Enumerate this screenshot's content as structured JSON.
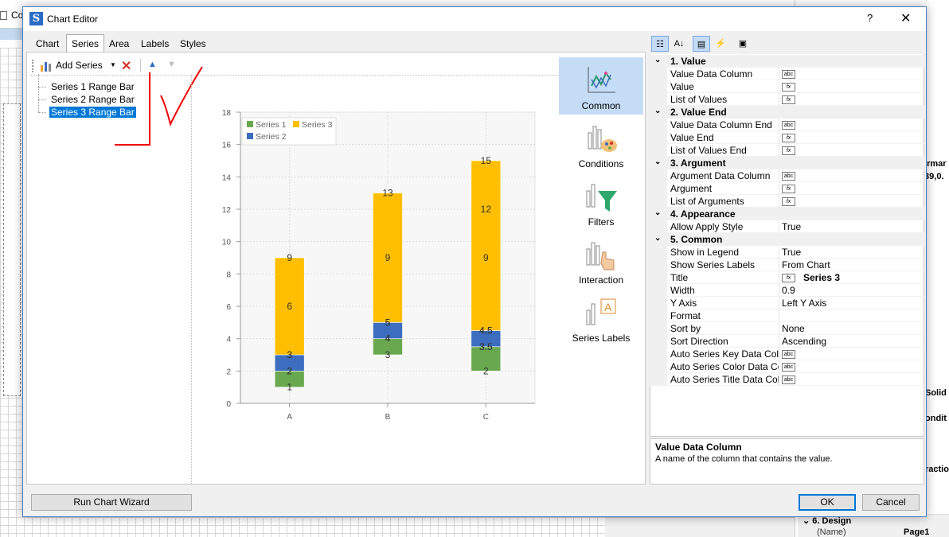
{
  "background": {
    "title": "Co",
    "right_fragments": [
      "r",
      "it",
      "ermar",
      ".39,0.",
      "Solid",
      "ondit",
      "ractio"
    ],
    "design_section": "6. Design",
    "design_name_label": "(Name)",
    "design_name_value": "Page1"
  },
  "dialog": {
    "title": "Chart Editor",
    "help": "?",
    "close": "✕"
  },
  "tabs": [
    "Chart",
    "Series",
    "Area",
    "Labels",
    "Styles"
  ],
  "active_tab": "Series",
  "toolbar": {
    "add_series": "Add Series",
    "caret": "▼",
    "delete_icon": "✕",
    "up_icon": "▲",
    "down_icon": "▼"
  },
  "series_list": [
    {
      "label": "Series 1 Range Bar",
      "selected": false
    },
    {
      "label": "Series 2 Range Bar",
      "selected": false
    },
    {
      "label": "Series 3 Range Bar",
      "selected": true
    }
  ],
  "nav": [
    {
      "label": "Common",
      "active": true
    },
    {
      "label": "Conditions",
      "active": false
    },
    {
      "label": "Filters",
      "active": false
    },
    {
      "label": "Interaction",
      "active": false
    },
    {
      "label": "Series Labels",
      "active": false
    }
  ],
  "chart_data": {
    "type": "bar",
    "subtype": "range-bar-stacked",
    "categories": [
      "A",
      "B",
      "C"
    ],
    "ylim": [
      0,
      18
    ],
    "yticks": [
      0,
      2,
      4,
      6,
      8,
      10,
      12,
      14,
      16,
      18
    ],
    "grid": true,
    "legend": [
      "Series 1",
      "Series 3",
      "Series 2"
    ],
    "legend_position": "top-left",
    "series": [
      {
        "name": "Series 1",
        "color": "#6aa84f",
        "ranges": [
          [
            1,
            2
          ],
          [
            3,
            4
          ],
          [
            2,
            3.5
          ]
        ],
        "labels": [
          [
            "1",
            "2"
          ],
          [
            "3",
            "4"
          ],
          [
            "2",
            "3.5"
          ]
        ]
      },
      {
        "name": "Series 2",
        "color": "#3c6dbf",
        "ranges": [
          [
            2,
            3
          ],
          [
            4,
            5
          ],
          [
            3.5,
            4.5
          ]
        ],
        "labels": [
          [
            "2",
            "3"
          ],
          [
            "4",
            "5"
          ],
          [
            "3.5",
            "4.5"
          ]
        ]
      },
      {
        "name": "Series 3",
        "color": "#ffbf00",
        "ranges": [
          [
            3,
            9
          ],
          [
            5,
            13
          ],
          [
            4.5,
            15
          ]
        ],
        "labels": [
          [
            "3",
            "6",
            "9"
          ],
          [
            "5",
            "9",
            "13"
          ],
          [
            "4.5",
            "9",
            "12",
            "15"
          ]
        ]
      }
    ]
  },
  "property_grid": {
    "toolbar": [
      "categorized-icon",
      "alphabetical-icon",
      "properties-icon",
      "events-icon",
      "pages-icon"
    ],
    "rows": [
      {
        "type": "cat",
        "name": "1. Value"
      },
      {
        "type": "prop",
        "name": "Value Data Column",
        "icon": "abc",
        "value": ""
      },
      {
        "type": "prop",
        "name": "Value",
        "icon": "fx",
        "value": ""
      },
      {
        "type": "prop",
        "name": "List of Values",
        "icon": "fx",
        "value": ""
      },
      {
        "type": "cat",
        "name": "2. Value  End"
      },
      {
        "type": "prop",
        "name": "Value Data Column End",
        "icon": "abc",
        "value": ""
      },
      {
        "type": "prop",
        "name": "Value End",
        "icon": "fx",
        "value": ""
      },
      {
        "type": "prop",
        "name": "List of Values End",
        "icon": "fx",
        "value": ""
      },
      {
        "type": "cat",
        "name": "3. Argument"
      },
      {
        "type": "prop",
        "name": "Argument Data Column",
        "icon": "abc",
        "value": ""
      },
      {
        "type": "prop",
        "name": "Argument",
        "icon": "fx",
        "value": ""
      },
      {
        "type": "prop",
        "name": "List of Arguments",
        "icon": "fx",
        "value": ""
      },
      {
        "type": "cat",
        "name": "4. Appearance"
      },
      {
        "type": "prop",
        "name": "Allow Apply Style",
        "icon": "",
        "value": "True"
      },
      {
        "type": "cat",
        "name": "5. Common"
      },
      {
        "type": "prop",
        "name": "Show in Legend",
        "icon": "",
        "value": "True"
      },
      {
        "type": "prop",
        "name": "Show Series Labels",
        "icon": "",
        "value": "From Chart"
      },
      {
        "type": "prop",
        "name": "Title",
        "icon": "fx",
        "value": "Series 3"
      },
      {
        "type": "prop",
        "name": "Width",
        "icon": "",
        "value": "0.9"
      },
      {
        "type": "prop",
        "name": "Y Axis",
        "icon": "",
        "value": "Left Y Axis"
      },
      {
        "type": "prop",
        "name": "Format",
        "icon": "",
        "value": ""
      },
      {
        "type": "prop",
        "name": "Sort by",
        "icon": "",
        "value": "None"
      },
      {
        "type": "prop",
        "name": "Sort Direction",
        "icon": "",
        "value": "Ascending"
      },
      {
        "type": "prop",
        "name": "Auto Series Key Data Column",
        "icon": "abc",
        "value": ""
      },
      {
        "type": "prop",
        "name": "Auto Series Color Data Column",
        "icon": "abc",
        "value": ""
      },
      {
        "type": "prop",
        "name": "Auto Series Title Data Column",
        "icon": "abc",
        "value": ""
      }
    ]
  },
  "description": {
    "heading": "Value Data Column",
    "text": "A name of the column that contains the value."
  },
  "buttons": {
    "wizard": "Run Chart Wizard",
    "ok": "OK",
    "cancel": "Cancel"
  }
}
